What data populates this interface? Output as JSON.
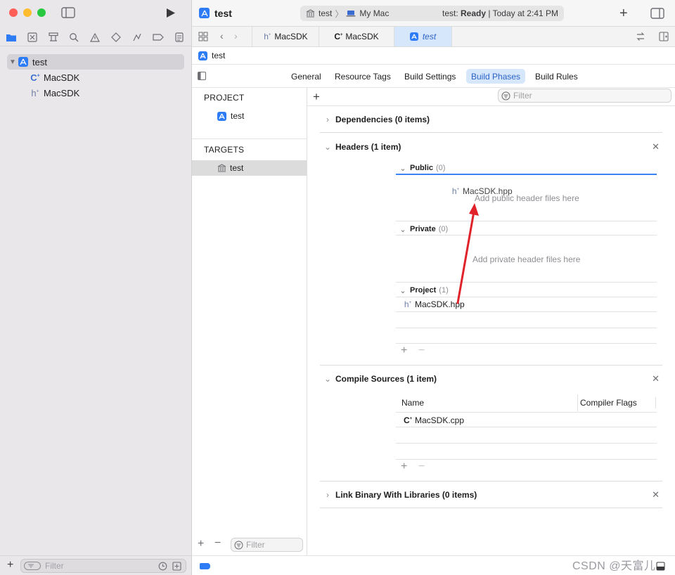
{
  "colors": {
    "accent": "#2d7cf6",
    "close": "#ff5f57",
    "minimize": "#febc2e",
    "zoom": "#28c840",
    "arrow": "#e0222a"
  },
  "toolbar": {
    "project_title": "test",
    "scheme": "test",
    "destination": "My Mac",
    "status_prefix": "test: ",
    "status_state": "Ready",
    "status_time": "| Today at 2:41 PM"
  },
  "tabs": [
    {
      "label": "MacSDK",
      "type_glyph": "h"
    },
    {
      "label": "MacSDK",
      "type_glyph": "C"
    },
    {
      "label": "test",
      "type_glyph": "app"
    }
  ],
  "jumpbar": {
    "label": "test"
  },
  "navigator": {
    "tree": [
      {
        "label": "test",
        "type_glyph": "app"
      },
      {
        "label": "MacSDK",
        "type_glyph": "C"
      },
      {
        "label": "MacSDK",
        "type_glyph": "h"
      }
    ],
    "filter_placeholder": "Filter"
  },
  "editor_tabs": [
    "General",
    "Resource Tags",
    "Build Settings",
    "Build Phases",
    "Build Rules"
  ],
  "editor_active_tab": "Build Phases",
  "target_list": {
    "project_header": "PROJECT",
    "project_item": "test",
    "targets_header": "TARGETS",
    "target_item": "test",
    "filter_placeholder": "Filter"
  },
  "phases": {
    "filter_placeholder": "Filter",
    "dependencies": "Dependencies (0 items)",
    "headers": {
      "title": "Headers (1 item)",
      "public_label": "Public",
      "public_count": "(0)",
      "public_placeholder": "Add public header files here",
      "dragged_file": "MacSDK.hpp",
      "private_label": "Private",
      "private_count": "(0)",
      "private_placeholder": "Add private header files here",
      "project_label": "Project",
      "project_count": "(1)",
      "project_file": "MacSDK.hpp"
    },
    "compile_sources": {
      "title": "Compile Sources (1 item)",
      "col_name": "Name",
      "col_flags": "Compiler Flags",
      "file": "MacSDK.cpp"
    },
    "link_binary": "Link Binary With Libraries (0 items)"
  },
  "watermark": "CSDN @天富儿"
}
